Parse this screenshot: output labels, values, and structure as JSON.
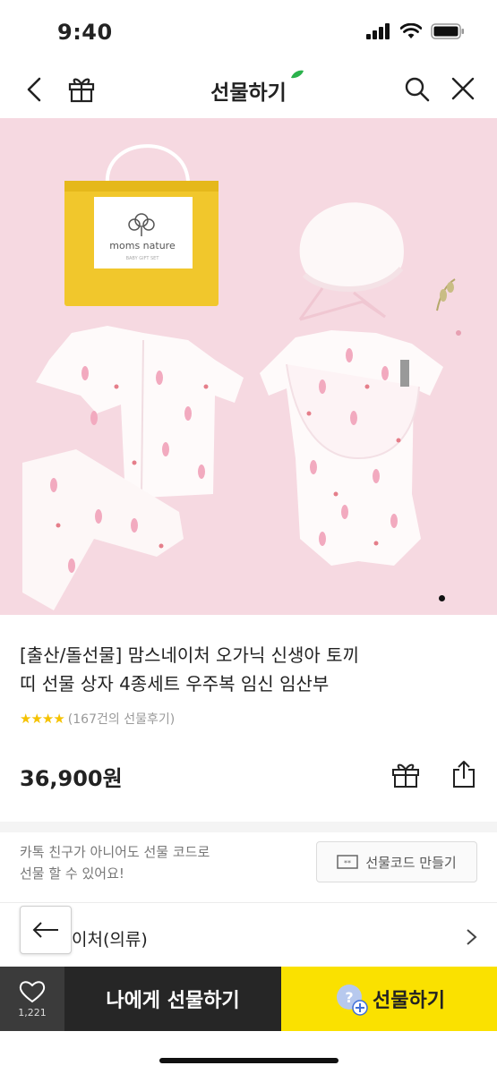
{
  "status": {
    "time": "9:40"
  },
  "header": {
    "title": "선물하기"
  },
  "product": {
    "brand_logo": "moms nature",
    "brand_logo_sub": "BABY GIFT SET",
    "title_line1": "[출산/돌선물] 맘스네이처 오가닉 신생아 토끼",
    "title_line2": "띠 선물 상자 4종세트 우주복 임신 임산부",
    "stars": "★★★★",
    "review_count": "(167건의 선물후기)",
    "price": "36,900원"
  },
  "promo": {
    "line1": "카톡 친구가 아니어도 선물 코드로",
    "line2": "선물 할 수 있어요!",
    "code_button_label": "선물코드 만들기"
  },
  "brand_row": {
    "label": "이처(의류)"
  },
  "bottom_bar": {
    "like_count": "1,221",
    "gift_me_label": "나에게 선물하기",
    "gift_friend_label": "선물하기"
  },
  "colors": {
    "accent_yellow": "#fae100",
    "dark": "#262626",
    "hero_bg": "#f6d9e1",
    "star": "#f5c200"
  }
}
